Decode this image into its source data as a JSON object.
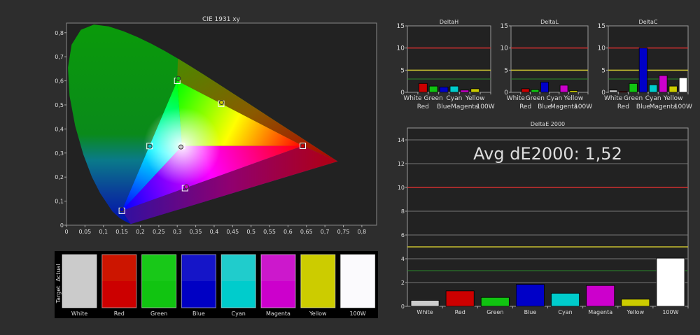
{
  "colors": {
    "White": "#cccccc",
    "Red": "#cc0000",
    "Green": "#11c411",
    "Blue": "#0000c8",
    "Cyan": "#00cccc",
    "Magenta": "#cc00cc",
    "Yellow": "#cccc00",
    "100W": "#ffffff",
    "ref_red": "#d03030",
    "ref_yellow": "#c8c030",
    "ref_green": "#2a8a2a"
  },
  "chart_data": [
    {
      "type": "scatter",
      "title": "CIE 1931 xy",
      "xlim": [
        0,
        0.84
      ],
      "ylim": [
        0,
        0.84
      ],
      "xticks": [
        "0",
        "0,05",
        "0,1",
        "0,15",
        "0,2",
        "0,25",
        "0,3",
        "0,35",
        "0,4",
        "0,45",
        "0,5",
        "0,55",
        "0,6",
        "0,65",
        "0,7",
        "0,75",
        "0,8"
      ],
      "yticks": [
        "0",
        "0,1",
        "0,2",
        "0,3",
        "0,4",
        "0,5",
        "0,6",
        "0,7",
        "0,8"
      ],
      "targets": [
        {
          "name": "Red",
          "x": 0.64,
          "y": 0.33
        },
        {
          "name": "Green",
          "x": 0.3,
          "y": 0.6
        },
        {
          "name": "Blue",
          "x": 0.15,
          "y": 0.06
        },
        {
          "name": "White",
          "x": 0.3127,
          "y": 0.329
        },
        {
          "name": "Cyan",
          "x": 0.225,
          "y": 0.329
        },
        {
          "name": "Magenta",
          "x": 0.321,
          "y": 0.154
        },
        {
          "name": "Yellow",
          "x": 0.419,
          "y": 0.505
        }
      ],
      "actual": [
        {
          "name": "Red",
          "x": 0.64,
          "y": 0.33
        },
        {
          "name": "Green",
          "x": 0.303,
          "y": 0.61
        },
        {
          "name": "Blue",
          "x": 0.15,
          "y": 0.065
        },
        {
          "name": "White",
          "x": 0.31,
          "y": 0.325
        },
        {
          "name": "Cyan",
          "x": 0.226,
          "y": 0.328
        },
        {
          "name": "Magenta",
          "x": 0.325,
          "y": 0.16
        },
        {
          "name": "Yellow",
          "x": 0.42,
          "y": 0.51
        }
      ]
    },
    {
      "type": "bar",
      "title": "DeltaH",
      "categories": [
        "White",
        "Red",
        "Green",
        "Blue",
        "Cyan",
        "Magenta",
        "Yellow",
        "100W"
      ],
      "values": [
        0,
        2.0,
        1.4,
        1.2,
        1.4,
        0.5,
        0.8,
        0
      ],
      "ylim": [
        0,
        15
      ],
      "yticks": [
        "0",
        "5",
        "10",
        "15"
      ],
      "reference_lines": [
        10,
        5,
        3
      ]
    },
    {
      "type": "bar",
      "title": "DeltaL",
      "categories": [
        "White",
        "Red",
        "Green",
        "Blue",
        "Cyan",
        "Magenta",
        "Yellow",
        "100W"
      ],
      "values": [
        0,
        0.8,
        0.6,
        2.3,
        0,
        1.6,
        0.4,
        0
      ],
      "ylim": [
        0,
        15
      ],
      "yticks": [
        "0",
        "5",
        "10",
        "15"
      ],
      "reference_lines": [
        10,
        5,
        3
      ]
    },
    {
      "type": "bar",
      "title": "DeltaC",
      "categories": [
        "White",
        "Red",
        "Green",
        "Blue",
        "Cyan",
        "Magenta",
        "Yellow",
        "100W"
      ],
      "values": [
        0.5,
        0.2,
        2.0,
        10.0,
        1.7,
        3.8,
        1.4,
        3.3
      ],
      "ylim": [
        0,
        15
      ],
      "yticks": [
        "0",
        "5",
        "10",
        "15"
      ],
      "reference_lines": [
        10,
        5,
        3
      ]
    },
    {
      "type": "bar",
      "title": "DeltaE 2000",
      "annotation": "Avg dE2000: 1,52",
      "categories": [
        "White",
        "Red",
        "Green",
        "Blue",
        "Cyan",
        "Magenta",
        "Yellow",
        "100W"
      ],
      "values": [
        0.5,
        1.3,
        0.75,
        1.85,
        1.1,
        1.75,
        0.6,
        4.05
      ],
      "ylim": [
        0,
        15
      ],
      "yticks": [
        "0",
        "2",
        "4",
        "6",
        "8",
        "10",
        "12",
        "14"
      ],
      "reference_lines": [
        10,
        5,
        3
      ]
    }
  ],
  "swatches": {
    "actual_label": "Actual",
    "target_label": "Target",
    "items": [
      {
        "label": "White",
        "actual": "#cbcbcb",
        "target": "#cbcbcb"
      },
      {
        "label": "Red",
        "actual": "#cc1500",
        "target": "#cc0000"
      },
      {
        "label": "Green",
        "actual": "#18c818",
        "target": "#11c411"
      },
      {
        "label": "Blue",
        "actual": "#1515c8",
        "target": "#0000c4"
      },
      {
        "label": "Cyan",
        "actual": "#20cccc",
        "target": "#00cccc"
      },
      {
        "label": "Magenta",
        "actual": "#cc18cc",
        "target": "#cc00cc"
      },
      {
        "label": "Yellow",
        "actual": "#cccc00",
        "target": "#cccc00"
      },
      {
        "label": "100W",
        "actual": "#fbfafd",
        "target": "#fbfafd"
      }
    ]
  }
}
